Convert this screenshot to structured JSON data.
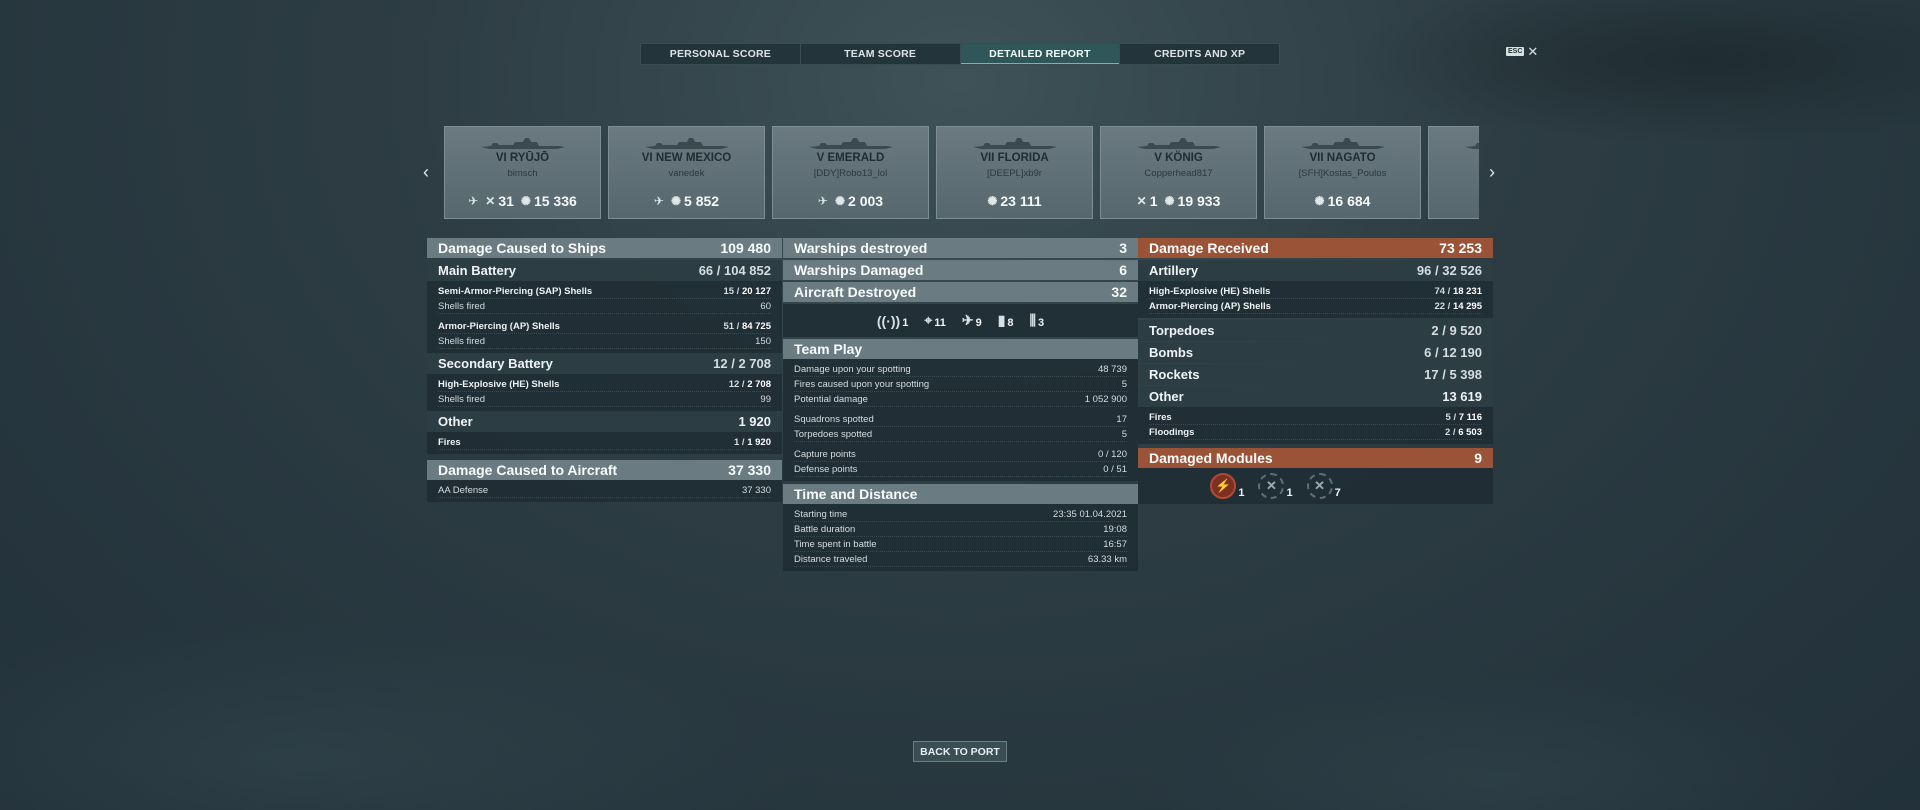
{
  "tabs": [
    "PERSONAL SCORE",
    "TEAM SCORE",
    "DETAILED REPORT",
    "CREDITS AND XP"
  ],
  "esc_key": "ESC",
  "close_glyph": "✕",
  "arrows": {
    "left": "‹",
    "right": "›"
  },
  "ships": [
    {
      "name": "VI RYŪJŌ",
      "player": "bimsch",
      "stats": [
        {
          "icon": "plane-kill-icon",
          "value": "31"
        },
        {
          "icon": "damage-icon",
          "value": "15 336"
        }
      ],
      "has_aircraft_icon": true
    },
    {
      "name": "VI NEW MEXICO",
      "player": "vanedek",
      "stats": [
        {
          "icon": "damage-icon",
          "value": "5 852"
        }
      ],
      "has_aircraft_icon": true
    },
    {
      "name": "V EMERALD",
      "player": "[DDY]Robo13_lol",
      "stats": [
        {
          "icon": "damage-icon",
          "value": "2 003"
        }
      ],
      "has_aircraft_icon": true
    },
    {
      "name": "VII FLORIDA",
      "player": "[DEEPL]xb9r",
      "stats": [
        {
          "icon": "damage-icon",
          "value": "23 111"
        }
      ],
      "has_aircraft_icon": false
    },
    {
      "name": "V KÖNIG",
      "player": "Copperhead817",
      "stats": [
        {
          "icon": "plane-kill-icon",
          "value": "1"
        },
        {
          "icon": "damage-icon",
          "value": "19 933"
        }
      ],
      "has_aircraft_icon": false
    },
    {
      "name": "VII NAGATO",
      "player": "[SFH]Kostas_Poulos",
      "stats": [
        {
          "icon": "damage-icon",
          "value": "16 684"
        }
      ],
      "has_aircraft_icon": false
    },
    {
      "name": "",
      "player": "",
      "stats": [],
      "has_aircraft_icon": false
    }
  ],
  "col1": {
    "header": {
      "label": "Damage Caused to Ships",
      "value": "109 480"
    },
    "main_battery": {
      "label": "Main Battery",
      "hits": "66",
      "value": "104 852"
    },
    "sap": {
      "label": "Semi-Armor-Piercing (SAP) Shells",
      "hits": "15",
      "value": "20 127"
    },
    "sap_fired": {
      "label": "Shells fired",
      "value": "60"
    },
    "ap": {
      "label": "Armor-Piercing (AP) Shells",
      "hits": "51",
      "value": "84 725"
    },
    "ap_fired": {
      "label": "Shells fired",
      "value": "150"
    },
    "secondary": {
      "label": "Secondary Battery",
      "hits": "12",
      "value": "2 708"
    },
    "he": {
      "label": "High-Explosive (HE) Shells",
      "hits": "12",
      "value": "2 708"
    },
    "he_fired": {
      "label": "Shells fired",
      "value": "99"
    },
    "other": {
      "label": "Other",
      "value": "1 920"
    },
    "fires": {
      "label": "Fires",
      "hits": "1",
      "value": "1 920"
    },
    "aircraft_header": {
      "label": "Damage Caused to Aircraft",
      "value": "37 330"
    },
    "aa": {
      "label": "AA Defense",
      "value": "37 330"
    }
  },
  "col2": {
    "destroyed": {
      "label": "Warships destroyed",
      "value": "3"
    },
    "damaged": {
      "label": "Warships Damaged",
      "value": "6"
    },
    "aircraft": {
      "label": "Aircraft Destroyed",
      "value": "32"
    },
    "icons": [
      {
        "icon": "radio-icon",
        "glyph": "((·))",
        "value": "1"
      },
      {
        "icon": "crosshair-icon",
        "glyph": "⌖",
        "value": "11"
      },
      {
        "icon": "plane-shot-icon",
        "glyph": "✈",
        "value": "9"
      },
      {
        "icon": "bomb-icon",
        "glyph": "▮",
        "value": "8"
      },
      {
        "icon": "rocket-icon",
        "glyph": "⫼",
        "value": "3"
      }
    ],
    "team_play": "Team Play",
    "tp_rows": [
      {
        "label": "Damage upon your spotting",
        "value": "48 739"
      },
      {
        "label": "Fires caused upon your spotting",
        "value": "5"
      },
      {
        "label": "Potential damage",
        "value": "1 052 900"
      }
    ],
    "tp_rows2": [
      {
        "label": "Squadrons spotted",
        "value": "17"
      },
      {
        "label": "Torpedoes spotted",
        "value": "5"
      }
    ],
    "tp_rows3": [
      {
        "label": "Capture points",
        "value": "0 / 120"
      },
      {
        "label": "Defense points",
        "value": "0 / 51"
      }
    ],
    "time_dist": "Time and Distance",
    "td_rows": [
      {
        "label": "Starting time",
        "value": "23:35  01.04.2021"
      },
      {
        "label": "Battle duration",
        "value": "19:08"
      },
      {
        "label": "Time spent in battle",
        "value": "16:57"
      },
      {
        "label": "Distance traveled",
        "value": "63.33 km"
      }
    ]
  },
  "col3": {
    "header": {
      "label": "Damage Received",
      "value": "73 253"
    },
    "artillery": {
      "label": "Artillery",
      "hits": "96",
      "value": "32 526"
    },
    "he": {
      "label": "High-Explosive (HE) Shells",
      "hits": "74",
      "value": "18 231"
    },
    "ap": {
      "label": "Armor-Piercing (AP) Shells",
      "hits": "22",
      "value": "14 295"
    },
    "torpedoes": {
      "label": "Torpedoes",
      "hits": "2",
      "value": "9 520"
    },
    "bombs": {
      "label": "Bombs",
      "hits": "6",
      "value": "12 190"
    },
    "rockets": {
      "label": "Rockets",
      "hits": "17",
      "value": "5 398"
    },
    "other": {
      "label": "Other",
      "value": "13 619"
    },
    "fires": {
      "label": "Fires",
      "hits": "5",
      "value": "7 116"
    },
    "floodings": {
      "label": "Floodings",
      "hits": "2",
      "value": "6 503"
    },
    "modules_header": {
      "label": "Damaged Modules",
      "value": "9"
    },
    "modules": [
      {
        "icon": "engine-module-icon",
        "glyph": "⚡",
        "value": "1",
        "state": "hot"
      },
      {
        "icon": "steering-module-icon",
        "glyph": "✕",
        "value": "1",
        "state": "dim"
      },
      {
        "icon": "turret-module-icon",
        "glyph": "✕",
        "value": "7",
        "state": "dim"
      }
    ]
  },
  "back_button": "BACK TO PORT"
}
